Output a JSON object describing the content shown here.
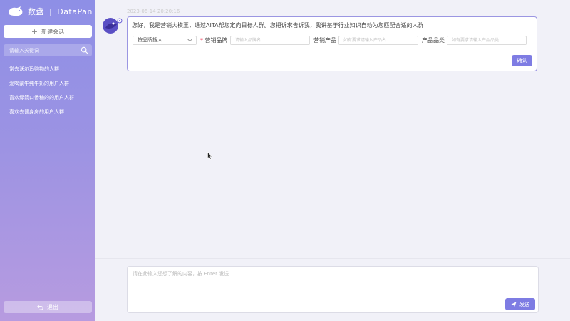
{
  "sidebar": {
    "logo": {
      "brand_cn": "数盘",
      "brand_en": "DataPan"
    },
    "new_chat_label": "新建会话",
    "search_placeholder": "请输入关键词",
    "sessions": [
      {
        "label": "常去沃尔玛购物的人群"
      },
      {
        "label": "爱喝蒙牛纯牛奶的用户人群"
      },
      {
        "label": "喜欢绿箭口香糖的的用户人群"
      },
      {
        "label": "喜欢去健身房的用户人群"
      }
    ],
    "logout_label": "退出"
  },
  "chat": {
    "timestamp": "2023-06-14 20:20:16",
    "message": "您好，我是营销大模王，通过AITA帮您定向目标人群。您把诉求告诉我，我讲基于行业知识自动为您匹配合适的人群",
    "form": {
      "select_value": "按品牌搜人",
      "brand_label": "营销品牌",
      "brand_placeholder": "请输入品牌名",
      "product_label": "营销产品",
      "product_placeholder": "如有要求请输入产品名",
      "category_label": "产品品类",
      "category_placeholder": "如有要求请输入产品品类"
    },
    "confirm_label": "确认"
  },
  "composer": {
    "placeholder": "请在此输入您想了解的内容，按 Enter 发送",
    "send_label": "发送"
  },
  "colors": {
    "accent": "#7e7ce3",
    "sidebar_top": "#8e8fe6",
    "sidebar_bottom": "#b79be0",
    "card_border": "#9b96e2",
    "required": "#e24"
  },
  "icons": [
    "logo-icon",
    "plus-icon",
    "search-icon",
    "logout-icon",
    "avatar-icon",
    "chevron-down-icon",
    "send-icon",
    "mouse-cursor-icon"
  ]
}
